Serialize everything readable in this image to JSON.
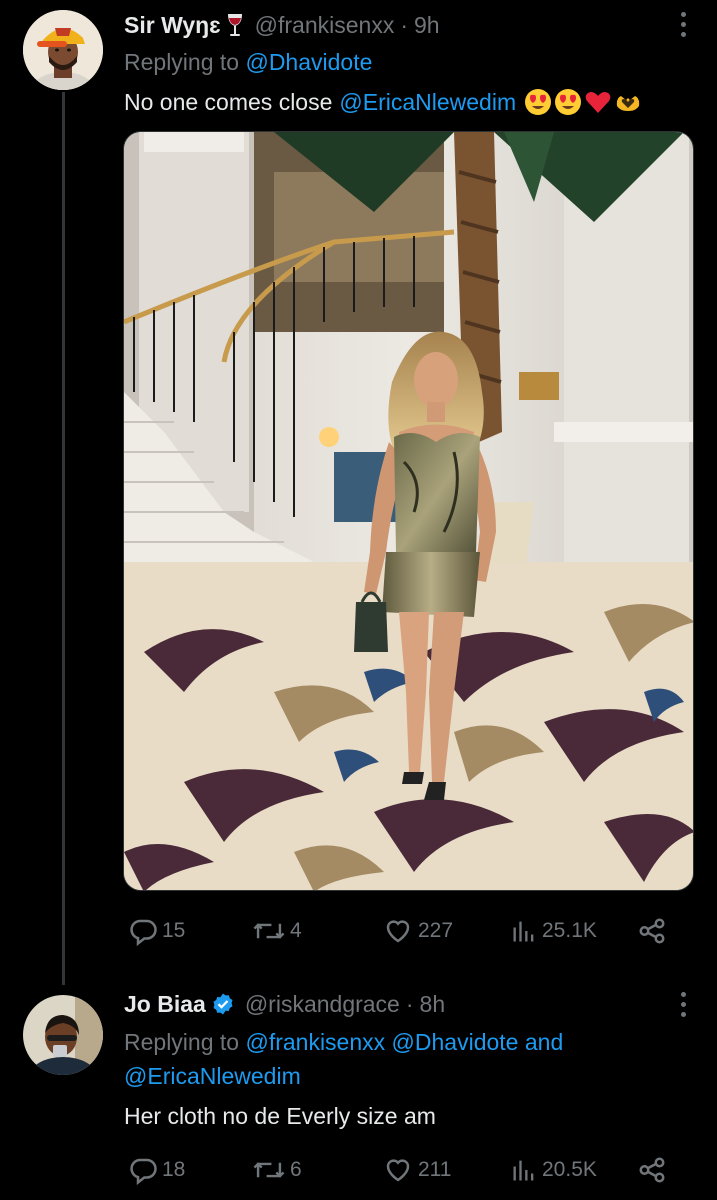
{
  "tweets": [
    {
      "name": "Sir Wyŋɛ",
      "handle": "@frankisenxx",
      "time": "9h",
      "replying_prefix": "Replying to",
      "replying_to": [
        "@Dhavidote"
      ],
      "text": "No one comes close",
      "text_mention": "@EricaNlewedim",
      "emojis": [
        "heart-eyes-face",
        "heart-eyes-face",
        "red-heart",
        "heart-hands"
      ],
      "actions": {
        "replies": "15",
        "retweets": "4",
        "likes": "227",
        "views": "25.1K"
      }
    },
    {
      "name": "Jo Biaa",
      "handle": "@riskandgrace",
      "time": "8h",
      "replying_prefix": "Replying to",
      "replying_line1": "@frankisenxx @Dhavidote and",
      "replying_line1_parts": {
        "a": "@frankisenxx",
        "b": "@Dhavidote",
        "c": "and"
      },
      "replying_line2": "@EricaNlewedim",
      "text": "Her cloth no de Everly size am",
      "actions": {
        "replies": "18",
        "retweets": "6",
        "likes": "211",
        "views": "20.5K"
      }
    }
  ],
  "colors": {
    "background": "#000000",
    "text": "#e7e9ea",
    "muted": "#71767b",
    "accent": "#1d9bf0",
    "verified": "#1d9bf0"
  }
}
